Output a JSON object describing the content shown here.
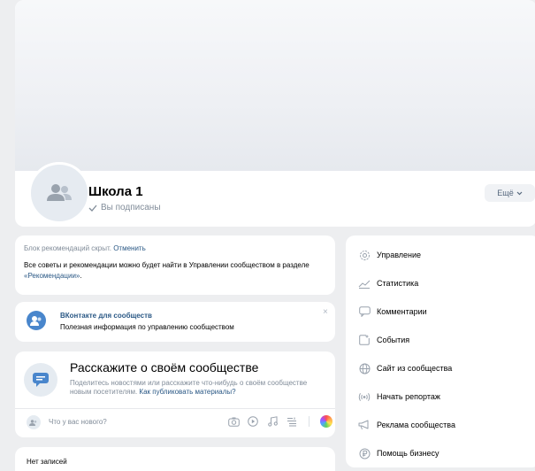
{
  "group": {
    "name": "Школа 1",
    "subscribed": "Вы подписаны",
    "more_label": "Ещё"
  },
  "recommendations": {
    "hidden_text": "Блок рекомендаций скрыт.",
    "cancel_label": "Отменить",
    "info_text": "Все советы и рекомендации можно будет найти в Управлении сообществом в разделе",
    "link_text": "«Рекомендации»",
    "info_end": "."
  },
  "vk_promo": {
    "title": "ВКонтакте для сообществ",
    "subtitle": "Полезная информация по управлению сообществом",
    "close": "×"
  },
  "tell": {
    "title": "Расскажите о своём сообществе",
    "desc": "Поделитесь новостями или расскажите что-нибудь о своём сообществе новым посетителям.",
    "link": "Как публиковать материалы?",
    "what_new": "Что у вас нового?"
  },
  "wall": {
    "empty": "Нет записей"
  },
  "menu": {
    "items": [
      {
        "label": "Управление",
        "icon": "gear-icon"
      },
      {
        "label": "Статистика",
        "icon": "chart-icon"
      },
      {
        "label": "Комментарии",
        "icon": "comment-icon"
      },
      {
        "label": "События",
        "icon": "event-icon"
      },
      {
        "label": "Сайт из сообщества",
        "icon": "globe-icon"
      },
      {
        "label": "Начать репортаж",
        "icon": "broadcast-icon"
      },
      {
        "label": "Реклама сообщества",
        "icon": "megaphone-icon"
      },
      {
        "label": "Помощь бизнесу",
        "icon": "ruble-icon"
      }
    ]
  },
  "colors": {
    "accent": "#2a5885",
    "muted": "#818c99",
    "background": "#edeef0",
    "card": "#ffffff"
  }
}
